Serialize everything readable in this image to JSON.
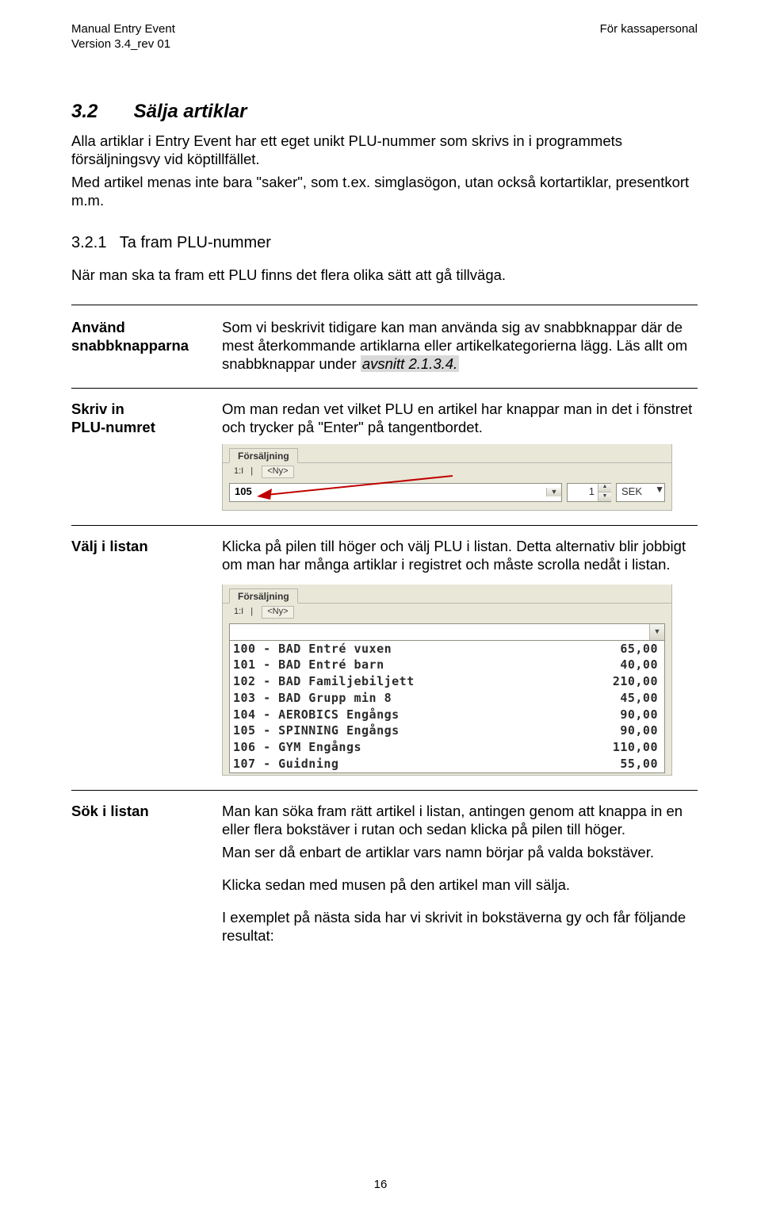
{
  "header": {
    "left_line1": "Manual Entry Event",
    "left_line2": "Version 3.4_rev 01",
    "right_line1": "För kassapersonal"
  },
  "section": {
    "number": "3.2",
    "title": "Sälja artiklar",
    "p1": "Alla artiklar i Entry Event har ett eget unikt PLU-nummer som skrivs in i programmets försäljningsvy vid köptillfället.",
    "p2": "Med artikel menas inte bara \"saker\", som t.ex. simglasögon, utan också kortartiklar, presentkort m.m."
  },
  "subsection": {
    "number": "3.2.1",
    "title": "Ta fram PLU-nummer",
    "p1": "När man ska ta fram ett PLU finns det flera olika sätt att gå tillväga."
  },
  "row1": {
    "label_line1": "Använd",
    "label_line2": "snabbknapparna",
    "text_a": "Som vi beskrivit tidigare kan man använda sig av snabbknappar där de mest återkommande artiklarna eller artikelkategorierna lägg. Läs allt om snabbknappar under ",
    "text_hl": "avsnitt 2.1.3.4.",
    "text_b": ""
  },
  "row2": {
    "label_line1": "Skriv in",
    "label_line2": "PLU-numret",
    "text": "Om man redan vet vilket PLU en artikel har knappar man in det i fönstret och  trycker på \"Enter\" på tangentbordet."
  },
  "shot1": {
    "tab": "Försäljning",
    "prefix": "1:I",
    "ny": "<Ny>",
    "plu_value": "105",
    "qty": "1",
    "currency": "SEK"
  },
  "row3": {
    "label": "Välj i listan",
    "text": "Klicka på pilen till höger och välj PLU i listan. Detta alternativ blir jobbigt om man har många artiklar i registret och måste scrolla nedåt i listan."
  },
  "shot2": {
    "tab": "Försäljning",
    "prefix": "1:I",
    "ny": "<Ny>",
    "items": [
      {
        "code": "100",
        "name": "BAD Entré vuxen",
        "price": "65,00"
      },
      {
        "code": "101",
        "name": "BAD Entré barn",
        "price": "40,00"
      },
      {
        "code": "102",
        "name": "BAD Familjebiljett",
        "price": "210,00"
      },
      {
        "code": "103",
        "name": "BAD Grupp min 8",
        "price": "45,00"
      },
      {
        "code": "104",
        "name": "AEROBICS Engångs",
        "price": "90,00"
      },
      {
        "code": "105",
        "name": "SPINNING Engångs",
        "price": "90,00"
      },
      {
        "code": "106",
        "name": "GYM Engångs",
        "price": "110,00"
      },
      {
        "code": "107",
        "name": "Guidning",
        "price": "55,00"
      }
    ]
  },
  "row4": {
    "label": "Sök i listan",
    "p1": "Man kan söka fram rätt artikel i listan, antingen genom att knappa in en eller flera bokstäver i rutan och sedan klicka på pilen till höger.",
    "p2": "Man ser då enbart de artiklar vars namn börjar på valda bokstäver.",
    "p3": "Klicka sedan med musen på den artikel man vill sälja.",
    "p4": "I exemplet på nästa sida har vi skrivit in bokstäverna gy och får följande resultat:"
  },
  "page_number": "16"
}
